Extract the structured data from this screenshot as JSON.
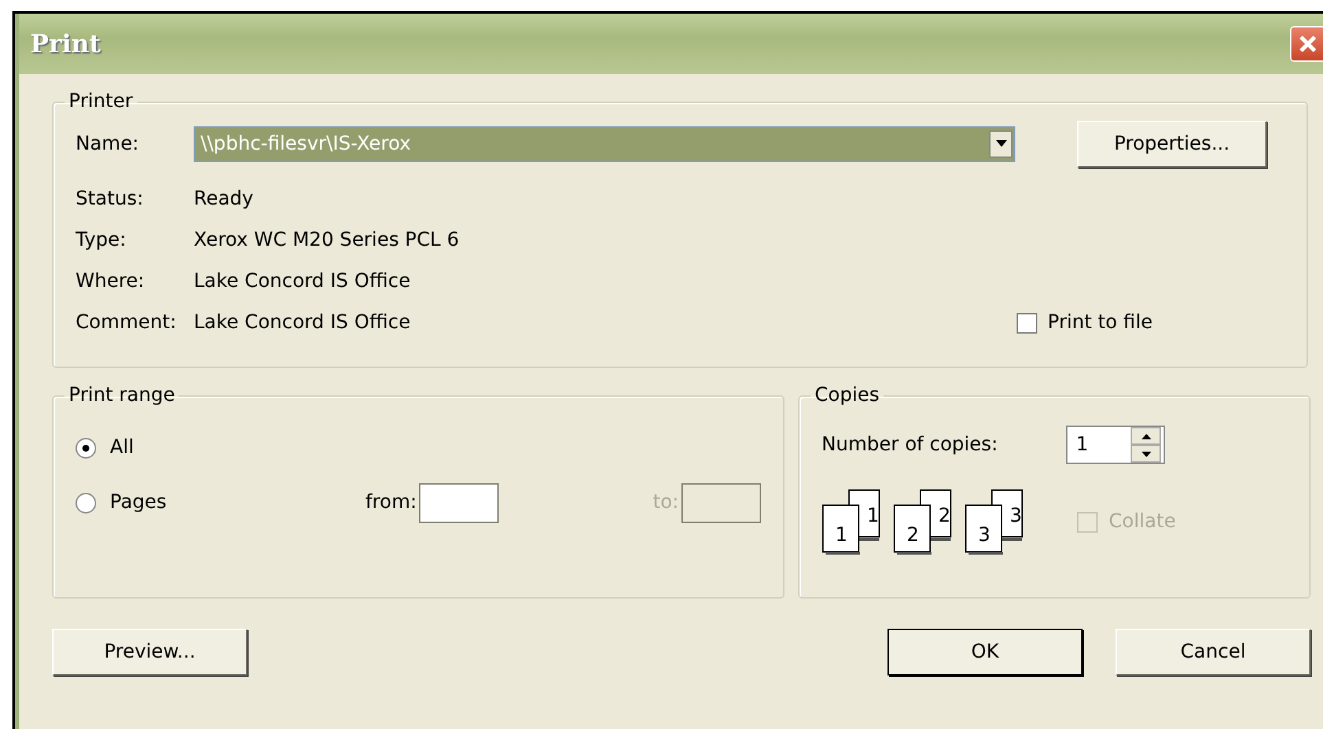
{
  "window": {
    "title": "Print"
  },
  "printer": {
    "title": "Printer",
    "name_label": "Name:",
    "name_value": "\\\\pbhc-filesvr\\IS-Xerox",
    "properties_button": "Properties...",
    "info": [
      {
        "label": "Status:",
        "value": "Ready"
      },
      {
        "label": "Type:",
        "value": "Xerox WC M20 Series PCL 6"
      },
      {
        "label": "Where:",
        "value": "Lake Concord IS Office"
      },
      {
        "label": "Comment:",
        "value": "Lake Concord IS Office"
      }
    ],
    "print_to_file": {
      "label": "Print to file",
      "checked": false
    }
  },
  "print_range": {
    "title": "Print range",
    "options": [
      {
        "label": "All",
        "selected": true
      },
      {
        "label": "Pages",
        "selected": false
      }
    ],
    "from": {
      "label": "from:",
      "disabled": false
    },
    "to": {
      "label": "to:",
      "disabled": true
    }
  },
  "copies": {
    "title": "Copies",
    "count_label": "Number of copies:",
    "count_value": "1",
    "stacks": [
      {
        "front": "1",
        "back": "1"
      },
      {
        "front": "2",
        "back": "2"
      },
      {
        "front": "3",
        "back": "3"
      }
    ],
    "collate": {
      "label": "Collate",
      "checked": false,
      "disabled": true
    }
  },
  "buttons": {
    "preview": "Preview...",
    "ok": "OK",
    "cancel": "Cancel"
  }
}
